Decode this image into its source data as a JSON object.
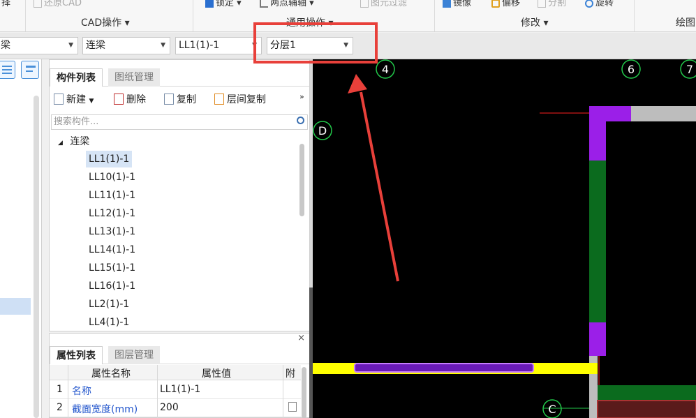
{
  "ribbon": {
    "top_items": [
      {
        "label": "择",
        "dim": false
      },
      {
        "label": "还原CAD",
        "dim": true
      },
      {
        "label": "锁定",
        "dim": false
      },
      {
        "label": "两点辅轴",
        "dim": false
      },
      {
        "label": "图元过滤",
        "dim": true
      },
      {
        "label": "镜像",
        "dim": false
      },
      {
        "label": "偏移",
        "dim": false
      },
      {
        "label": "分割",
        "dim": true
      },
      {
        "label": "旋转",
        "dim": false
      }
    ],
    "groups": [
      {
        "label": "CAD操作 ▾"
      },
      {
        "label": "通用操作 ▾"
      },
      {
        "label": "修改 ▾"
      },
      {
        "label": "绘图"
      }
    ]
  },
  "combo_bar": {
    "combos": [
      {
        "value": "梁"
      },
      {
        "value": "连梁"
      },
      {
        "value": "LL1(1)-1"
      },
      {
        "value": "分层1"
      }
    ]
  },
  "component_panel": {
    "tabs": [
      {
        "label": "构件列表",
        "active": true
      },
      {
        "label": "图纸管理",
        "active": false
      }
    ],
    "tools": {
      "new": "新建",
      "delete": "删除",
      "copy": "复制",
      "floor_copy": "层间复制",
      "more": "»"
    },
    "search_placeholder": "搜索构件...",
    "tree_root": "连梁",
    "items": [
      {
        "label": "LL1(1)-1",
        "selected": true
      },
      {
        "label": "LL10(1)-1",
        "selected": false
      },
      {
        "label": "LL11(1)-1",
        "selected": false
      },
      {
        "label": "LL12(1)-1",
        "selected": false
      },
      {
        "label": "LL13(1)-1",
        "selected": false
      },
      {
        "label": "LL14(1)-1",
        "selected": false
      },
      {
        "label": "LL15(1)-1",
        "selected": false
      },
      {
        "label": "LL16(1)-1",
        "selected": false
      },
      {
        "label": "LL2(1)-1",
        "selected": false
      },
      {
        "label": "LL4(1)-1",
        "selected": false
      }
    ]
  },
  "property_panel": {
    "close": "×",
    "tabs": [
      {
        "label": "属性列表",
        "active": true
      },
      {
        "label": "图层管理",
        "active": false
      }
    ],
    "headers": {
      "name": "属性名称",
      "value": "属性值",
      "extra": "附"
    },
    "rows": [
      {
        "index": "1",
        "name": "名称",
        "value": "LL1(1)-1"
      },
      {
        "index": "2",
        "name": "截面宽度(mm)",
        "value": "200"
      }
    ]
  },
  "canvas": {
    "axis_labels": [
      {
        "label": "4"
      },
      {
        "label": "6"
      },
      {
        "label": "7"
      },
      {
        "label": "D"
      },
      {
        "label": "C"
      }
    ],
    "colors": {
      "background": "#000000",
      "beam_yellow": "#ffff00",
      "beam_purple": "#9b1fe8",
      "wall_green": "#0b6b1e",
      "grid_red": "#ff2020",
      "axis_circle": "#22c84a",
      "annotation_red": "#e8403a"
    }
  }
}
